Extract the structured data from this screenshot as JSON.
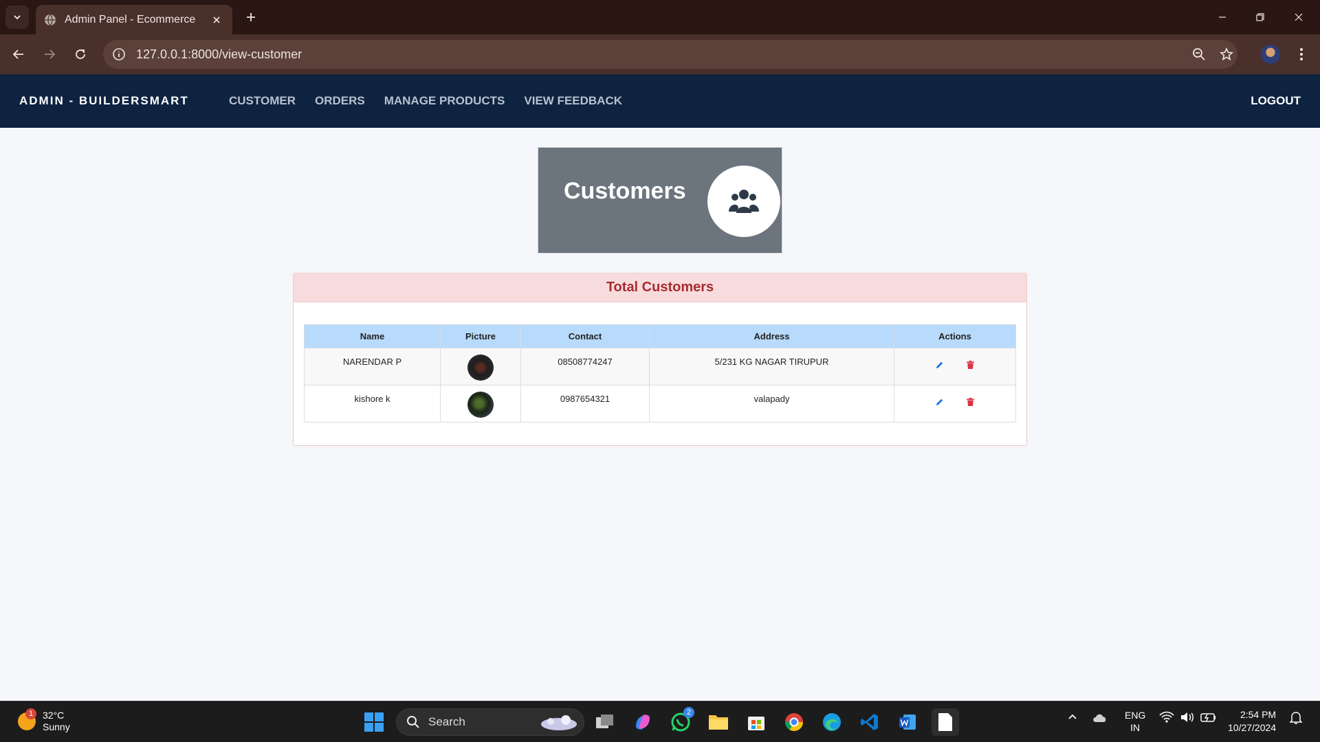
{
  "browser": {
    "tab_title": "Admin Panel - Ecommerce",
    "url": "127.0.0.1:8000/view-customer"
  },
  "nav": {
    "brand": "ADMIN - BUILDERSMART",
    "links": [
      "CUSTOMER",
      "ORDERS",
      "MANAGE PRODUCTS",
      "VIEW FEEDBACK"
    ],
    "logout": "LOGOUT"
  },
  "summary": {
    "heading": "Customers",
    "icon": "users-icon"
  },
  "card": {
    "header": "Total Customers",
    "columns": [
      "Name",
      "Picture",
      "Contact",
      "Address",
      "Actions"
    ],
    "rows": [
      {
        "name": "NARENDAR P",
        "contact": "08508774247",
        "address": "5/231 KG NAGAR TIRUPUR"
      },
      {
        "name": "kishore k",
        "contact": "0987654321",
        "address": "valapady"
      }
    ],
    "actions": {
      "edit_icon": "pencil-icon",
      "delete_icon": "trash-icon",
      "edit_color": "#1a73e8",
      "delete_color": "#dc3545"
    }
  },
  "taskbar": {
    "weather_temp": "32°C",
    "weather_desc": "Sunny",
    "weather_badge": "1",
    "search_label": "Search",
    "whatsapp_badge": "2",
    "lang_top": "ENG",
    "lang_bottom": "IN",
    "time": "2:54 PM",
    "date": "10/27/2024"
  },
  "colors": {
    "navbar": "#0d2340",
    "summary_bg": "#6c757d",
    "card_header_bg": "#f8dcdd",
    "card_header_text": "#a52c32",
    "table_head_bg": "#b8dafc"
  }
}
